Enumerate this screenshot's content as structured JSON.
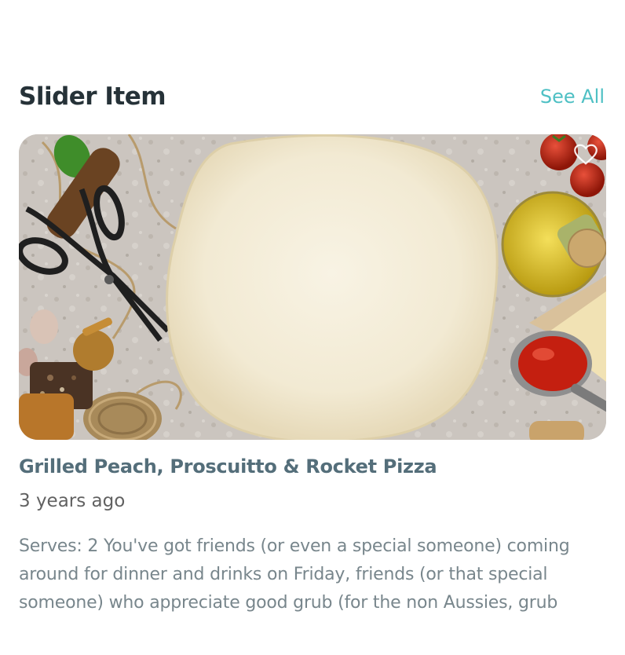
{
  "section": {
    "title": "Slider Item",
    "see_all_label": "See All"
  },
  "card": {
    "title": "Grilled Peach, Proscuitto & Rocket Pizza",
    "date": "3 years ago",
    "excerpt": "Serves: 2 You've got friends (or even a special someone) coming around for dinner and drinks on Friday, friends (or that special someone) who appreciate good grub (for the non Aussies, grub",
    "favorite_icon": "heart-outline-icon",
    "image_subject": "pizza-dough-photo"
  },
  "colors": {
    "title": "#263238",
    "accent": "#4ec0c4",
    "card_title": "#546e7a",
    "date": "#616161",
    "excerpt": "#78868c"
  }
}
